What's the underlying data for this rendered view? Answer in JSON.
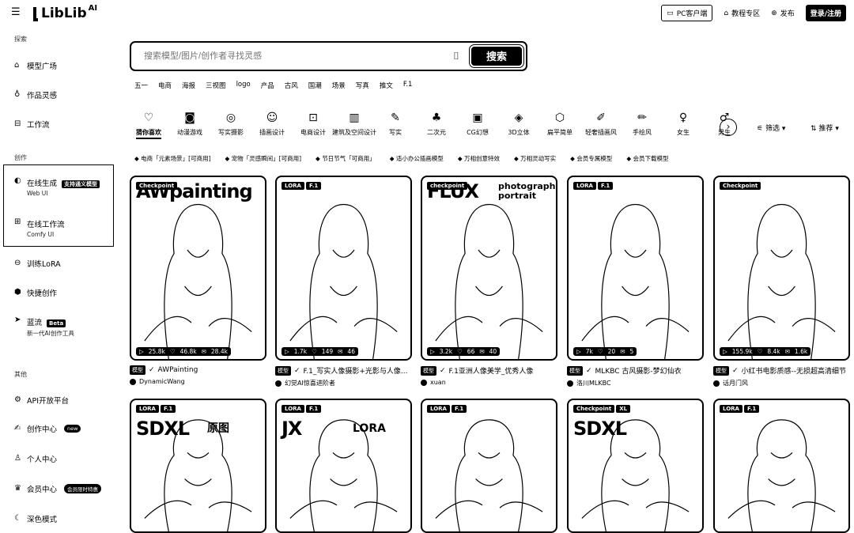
{
  "header": {
    "logo_text": "LibLib",
    "logo_sup": "AI",
    "pc_client": "PC客户端",
    "tutorial": "教程专区",
    "publish": "发布",
    "login": "登录/注册"
  },
  "sidebar": {
    "section_discover": "探索",
    "model_square": "模型广场",
    "works_inspiration": "作品灵感",
    "workflow": "工作流",
    "section_create": "创作",
    "online_gen": "在线生成",
    "online_gen_badge": "支持通义模型",
    "online_gen_sub": "Web UI",
    "online_workflow": "在线工作流",
    "online_workflow_sub": "Comfy UI",
    "train_lora": "训练LoRA",
    "quick_create": "快捷创作",
    "lanliu": "蓝流",
    "lanliu_badge": "Beta",
    "lanliu_sub": "新一代AI创作工具",
    "section_other": "其他",
    "api": "API开放平台",
    "creator_center": "创作中心",
    "creator_badge": "new",
    "personal": "个人中心",
    "member": "会员中心",
    "member_badge": "会员限时特惠",
    "dark_mode": "深色模式"
  },
  "search": {
    "placeholder": "搜索模型/图片/创作者寻找灵感",
    "button": "搜索"
  },
  "hot_tags": [
    "五一",
    "电商",
    "海报",
    "三视图",
    "logo",
    "产品",
    "古风",
    "国潮",
    "场景",
    "写真",
    "推文",
    "F.1"
  ],
  "categories": [
    {
      "icon": "♡",
      "label": "猜你喜欢"
    },
    {
      "icon": "◙",
      "label": "动漫游戏"
    },
    {
      "icon": "◎",
      "label": "写实摄影"
    },
    {
      "icon": "☺",
      "label": "插画设计"
    },
    {
      "icon": "⊡",
      "label": "电商设计"
    },
    {
      "icon": "▥",
      "label": "建筑及空间设计"
    },
    {
      "icon": "✎",
      "label": "写实"
    },
    {
      "icon": "♣",
      "label": "二次元"
    },
    {
      "icon": "▣",
      "label": "CG幻想"
    },
    {
      "icon": "◈",
      "label": "3D立体"
    },
    {
      "icon": "⬡",
      "label": "扁平简单"
    },
    {
      "icon": "✐",
      "label": "轻奢插画风"
    },
    {
      "icon": "✏",
      "label": "手绘风"
    },
    {
      "icon": "♀",
      "label": "女生"
    },
    {
      "icon": "♂",
      "label": "男生"
    }
  ],
  "filter_label": "筛选",
  "sort_label": "推荐",
  "topics": [
    "电商「元素场景」[可商用]",
    "宠物「灵感瞬间」[可商用]",
    "节日节气「可商用」",
    "适小办公插画模型",
    "万相创意特效",
    "万相灵动写实",
    "会员专属模型",
    "会员下载模型"
  ],
  "cards_row1": [
    {
      "tags": [
        "Checkpoint"
      ],
      "overlay": "AWpainting",
      "overlay_sub": "",
      "stats": [
        "25.8k",
        "46.8k",
        "28.4k"
      ],
      "type": "模型",
      "title": "AWPainting",
      "author": "DynamicWang"
    },
    {
      "tags": [
        "LORA",
        "F.1"
      ],
      "overlay": "",
      "overlay_sub": "",
      "stats": [
        "1.7k",
        "149",
        "46"
      ],
      "type": "模型",
      "title": "F.1_写实人像摄影+光影与人像...",
      "author": "幻觉AI惊喜进阶者"
    },
    {
      "tags": [
        "checkpoint"
      ],
      "overlay": "FLUX",
      "overlay_sub": "photography portrait",
      "stats": [
        "3.2k",
        "66",
        "40"
      ],
      "type": "模型",
      "title": "F.1亚洲人像美学_优秀人像",
      "author": "xuan"
    },
    {
      "tags": [
        "LORA",
        "F.1"
      ],
      "overlay": "",
      "overlay_sub": "",
      "stats": [
        "7k",
        "20",
        "5"
      ],
      "type": "模型",
      "title": "MLKBC 古风摄影-梦幻仙衣",
      "author": "洛川MLKBC"
    },
    {
      "tags": [
        "Checkpoint"
      ],
      "overlay": "",
      "overlay_sub": "",
      "stats": [
        "155.9k",
        "8.4k",
        "1.6k"
      ],
      "type": "模型",
      "title": "小红书电影质感--无损超高清细节",
      "author": "话月门风"
    }
  ],
  "cards_row2": [
    {
      "tags": [
        "LORA",
        "F.1"
      ],
      "overlay": "SDXL",
      "overlay_sub": "原图"
    },
    {
      "tags": [
        "LORA",
        "F.1"
      ],
      "overlay": "JX",
      "overlay_sub": "LORA"
    },
    {
      "tags": [
        "LORA",
        "F.1"
      ],
      "overlay": "",
      "overlay_sub": ""
    },
    {
      "tags": [
        "Checkpoint",
        "XL"
      ],
      "overlay": "SDXL",
      "overlay_sub": ""
    },
    {
      "tags": [
        "LORA",
        "F.1"
      ],
      "overlay": "",
      "overlay_sub": ""
    }
  ]
}
